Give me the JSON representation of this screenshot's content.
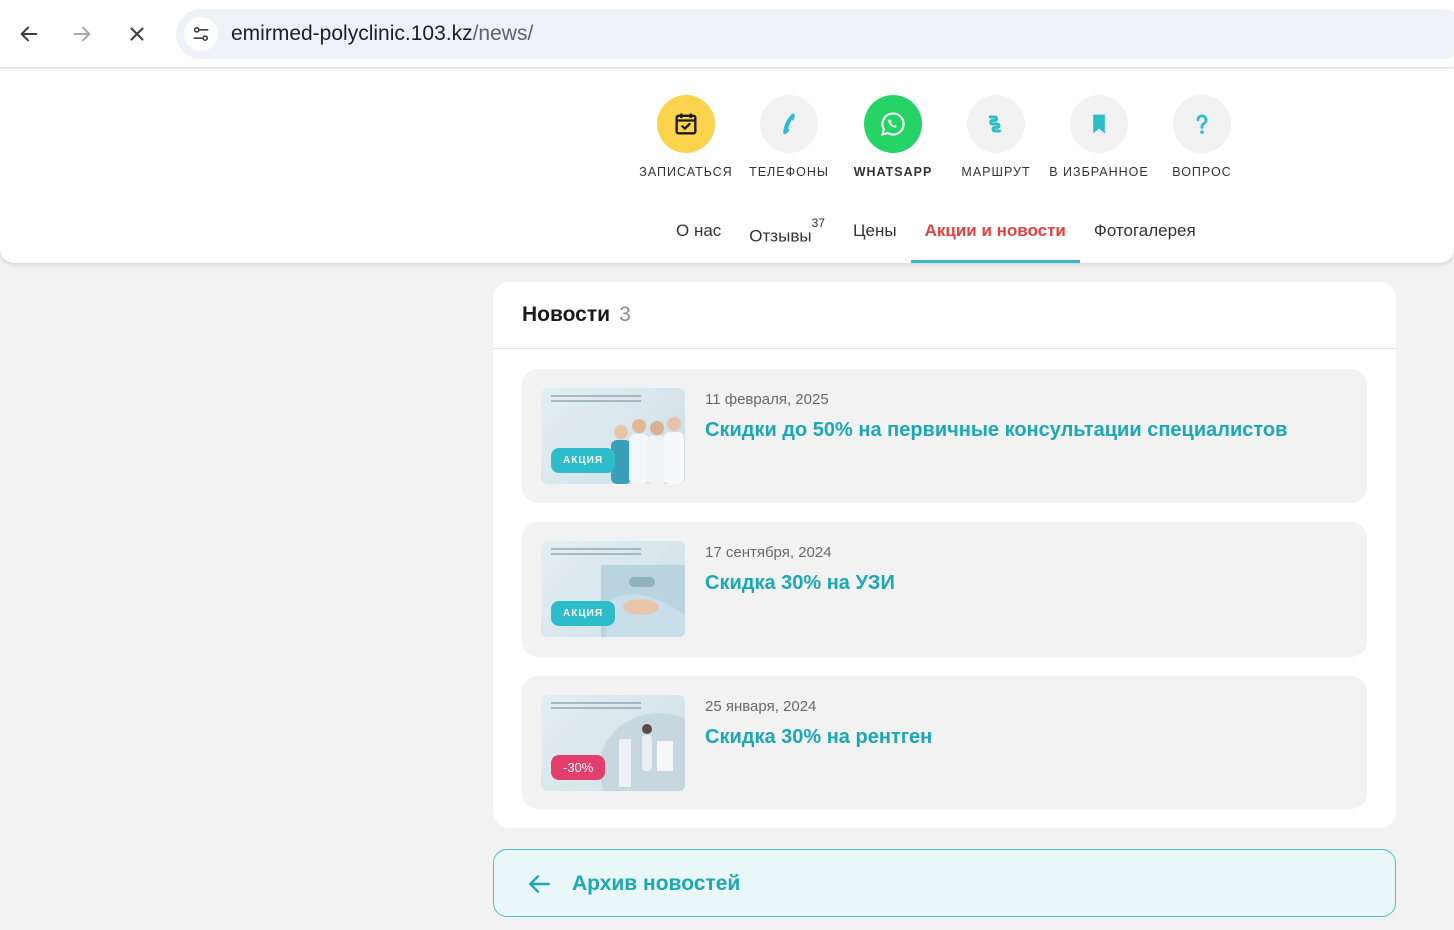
{
  "browser": {
    "url_host": "emirmed-polyclinic.103.kz",
    "url_path": "/news/"
  },
  "actions": [
    {
      "label": "ЗАПИСАТЬСЯ",
      "icon": "calendar-check-icon",
      "color": "#fcd34d"
    },
    {
      "label": "ТЕЛЕФОНЫ",
      "icon": "phone-icon",
      "color": "#f1f1f1"
    },
    {
      "label": "WHATSAPP",
      "icon": "whatsapp-icon",
      "color": "#25d366"
    },
    {
      "label": "МАРШРУТ",
      "icon": "route-icon",
      "color": "#f1f1f1"
    },
    {
      "label": "В ИЗБРАННОЕ",
      "icon": "bookmark-icon",
      "color": "#f1f1f1"
    },
    {
      "label": "ВОПРОС",
      "icon": "question-icon",
      "color": "#f1f1f1"
    }
  ],
  "tabs": [
    {
      "label": "О нас"
    },
    {
      "label": "Отзывы",
      "count": "37"
    },
    {
      "label": "Цены"
    },
    {
      "label": "Акции и новости",
      "active": true
    },
    {
      "label": "Фотогалерея"
    }
  ],
  "news": {
    "title": "Новости",
    "count": "3",
    "items": [
      {
        "date": "11 февраля, 2025",
        "title": "Скидки до 50% на первичные консультации специалистов",
        "badge": "АКЦИЯ"
      },
      {
        "date": "17 сентября, 2024",
        "title": "Скидка 30% на УЗИ",
        "badge": "АКЦИЯ"
      },
      {
        "date": "25 января, 2024",
        "title": "Скидка 30% на рентген",
        "badge": "-30%"
      }
    ]
  },
  "archive": {
    "label": "Архив новостей"
  },
  "colors": {
    "accent": "#1ba8b4",
    "active_tab": "#e5413e",
    "tab_underline": "#3fb6c7"
  }
}
